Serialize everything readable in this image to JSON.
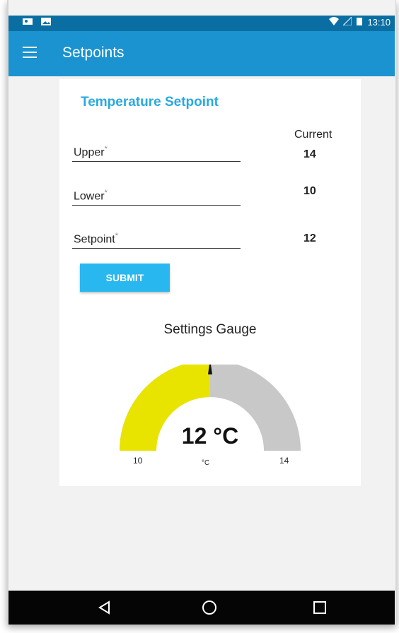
{
  "status_bar": {
    "time": "13:10"
  },
  "app_bar": {
    "title": "Setpoints"
  },
  "card": {
    "title": "Temperature Setpoint",
    "current_header": "Current",
    "fields": [
      {
        "label": "Upper",
        "required_mark": "*",
        "current": "14"
      },
      {
        "label": "Lower",
        "required_mark": "*",
        "current": "10"
      },
      {
        "label": "Setpoint",
        "required_mark": "*",
        "current": "12"
      }
    ],
    "submit_label": "SUBMIT"
  },
  "gauge": {
    "title": "Settings Gauge",
    "value_label": "12 °C",
    "unit": "°C",
    "min": "10",
    "max": "14",
    "value": 12,
    "range": [
      10,
      14
    ],
    "fill_color": "#e8e400",
    "track_color": "#c8c8c8",
    "needle_color": "#111111"
  },
  "nav": {
    "icons": [
      "back-icon",
      "home-icon",
      "recents-icon"
    ]
  },
  "colors": {
    "app_bar": "#1a93d0",
    "status_bar": "#0a6ea3",
    "accent": "#29a9e0",
    "button": "#29b7f0"
  }
}
